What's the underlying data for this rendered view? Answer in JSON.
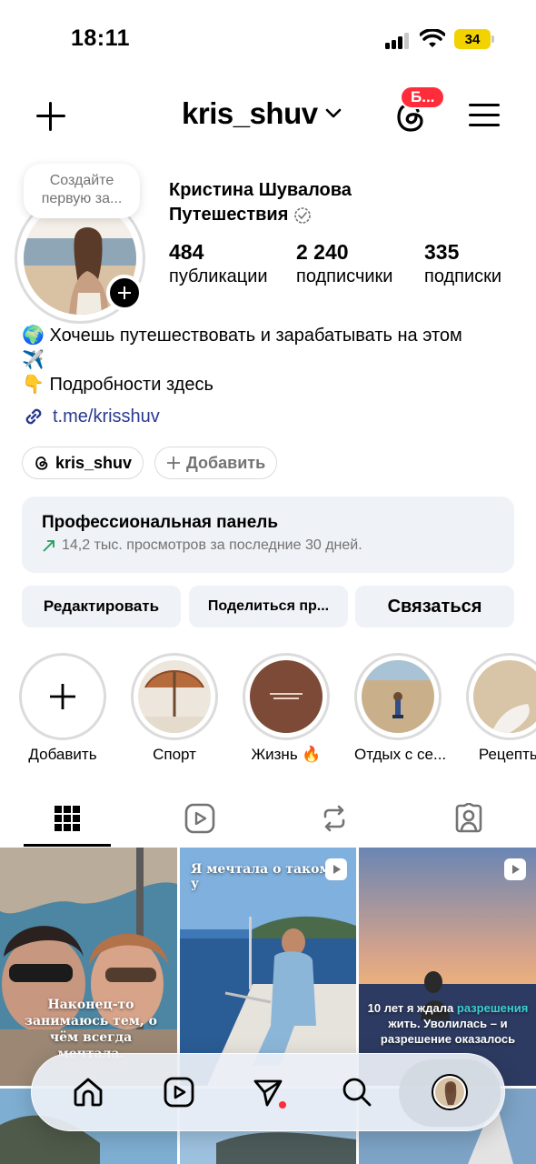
{
  "status_bar": {
    "time": "18:11",
    "battery": "34"
  },
  "nav": {
    "username": "kris_shuv",
    "threads_badge": "Б..."
  },
  "profile": {
    "note": "Создайте первую за...",
    "full_name": "Кристина Шувалова",
    "category": "Путешествия",
    "stats": [
      {
        "value": "484",
        "label": "публикации"
      },
      {
        "value": "2 240",
        "label": "подписчики"
      },
      {
        "value": "335",
        "label": "подписки"
      }
    ],
    "bio_line1": "🌍 Хочешь путешествовать и зарабатывать на этом",
    "bio_line2": "✈️",
    "bio_line3": "👇 Подробности здесь",
    "link": "t.me/krisshuv",
    "threads_pill": "kris_shuv",
    "add_pill": "Добавить"
  },
  "pro_panel": {
    "title": "Профессиональная панель",
    "subtitle": "14,2 тыс. просмотров за последние 30 дней."
  },
  "actions": {
    "edit": "Редактировать",
    "share": "Поделиться пр...",
    "contact": "Связаться"
  },
  "highlights": [
    {
      "label": "Добавить"
    },
    {
      "label": "Спорт"
    },
    {
      "label": "Жизнь 🔥"
    },
    {
      "label": "Отдых с се..."
    },
    {
      "label": "Рецепты"
    }
  ],
  "posts": {
    "post1_caption": "Наконец-то занимаюсь тем, о чём всегда мечтала.",
    "post2_caption": "Я мечтала о таком у",
    "post3_caption_a": "10 лет я ждала",
    "post3_caption_highlight": "разрешения",
    "post3_caption_b": "жить. Уволилась – и разрешение оказалось"
  },
  "colors": {
    "accent": "#ff2d3a",
    "link": "#2b3a8f",
    "panel_bg": "#eff2f6",
    "battery": "#f2d300"
  }
}
